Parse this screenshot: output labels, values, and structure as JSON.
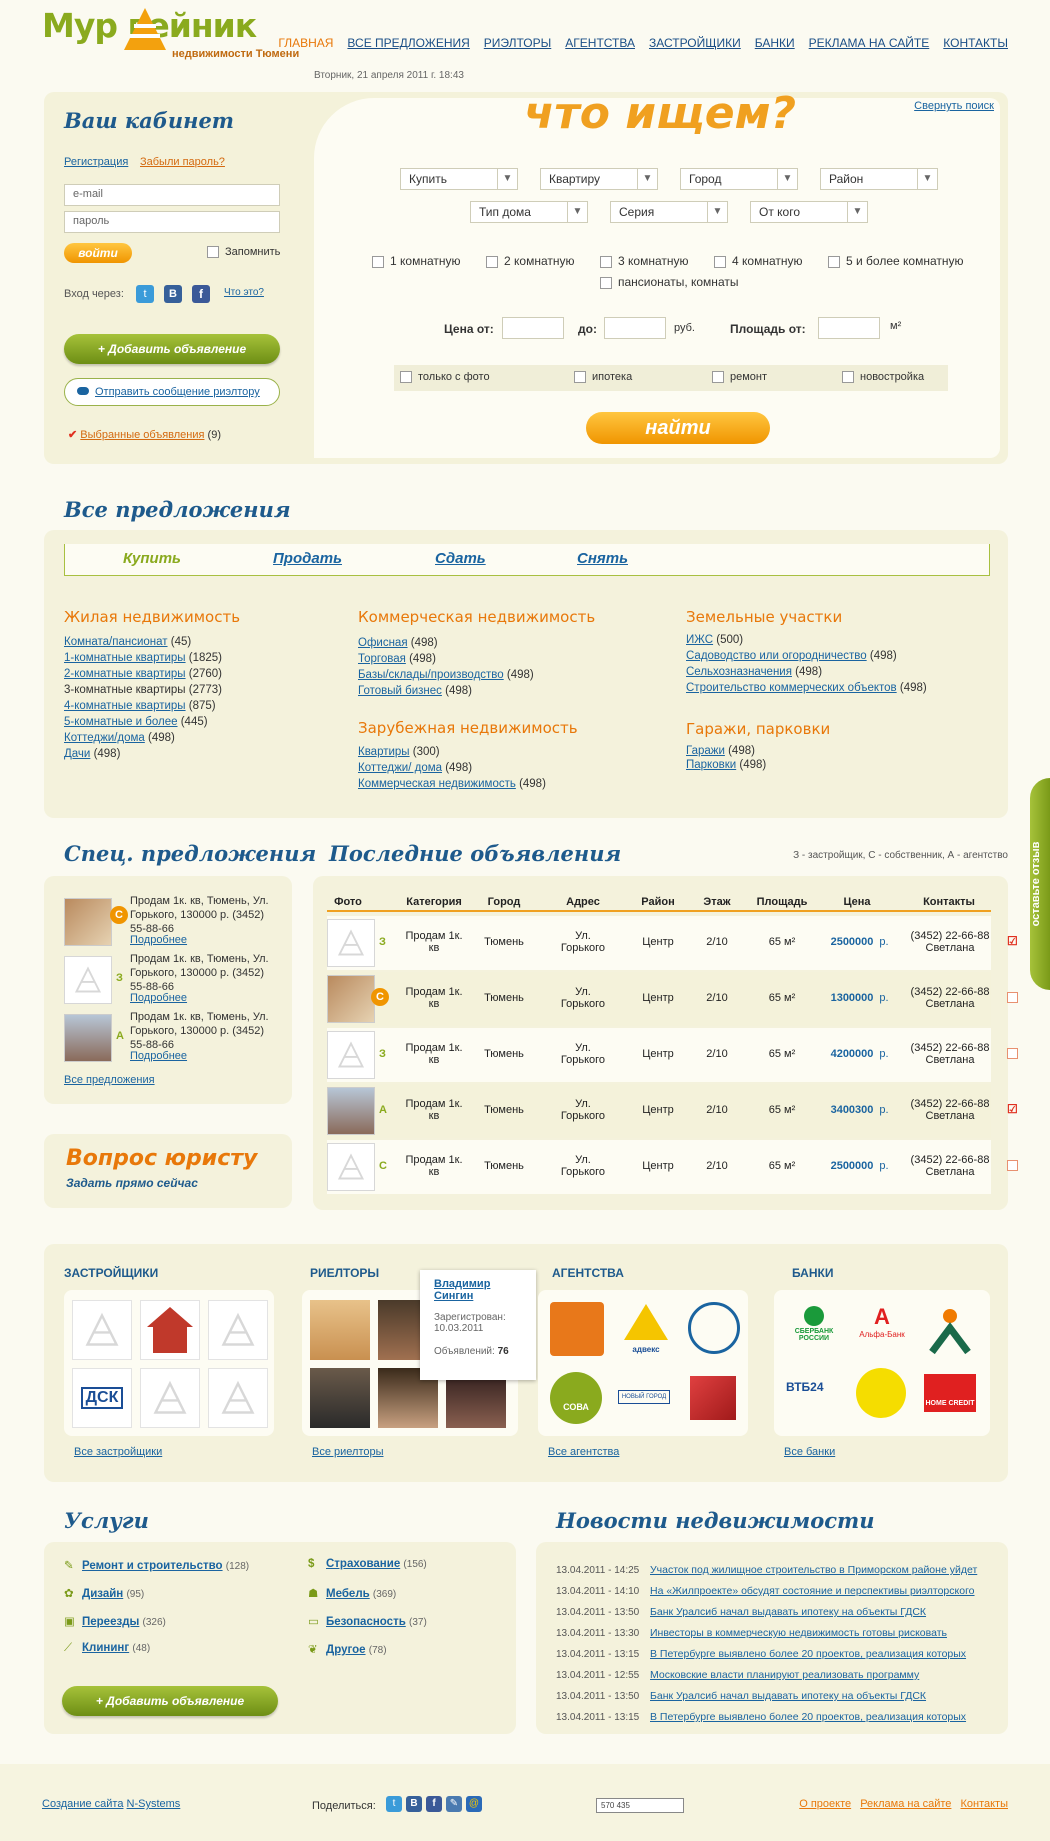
{
  "header": {
    "logo_text": "Мур    вейник",
    "logo_sub": "недвижимости Тюмени",
    "date": "Вторник, 21 апреля 2011 г. 18:43",
    "nav": [
      "ГЛАВНАЯ",
      "ВСЕ ПРЕДЛОЖЕНИЯ",
      "РИЭЛТОРЫ",
      "АГЕНТСТВА",
      "ЗАСТРОЙЩИКИ",
      "БАНКИ",
      "РЕКЛАМА НА САЙТЕ",
      "КОНТАКТЫ"
    ]
  },
  "cabinet": {
    "title": "Ваш кабинет",
    "register": "Регистрация",
    "forgot": "Забыли пароль?",
    "email_placeholder": "e-mail",
    "password_placeholder": "пароль",
    "login": "войти",
    "remember": "Запомнить",
    "login_via": "Вход через:",
    "what": "Что это?",
    "add": "+ Добавить объявление",
    "send": "Отправить сообщение риэлтору",
    "favorites": "Выбранные объявления",
    "favorites_count": "(9)"
  },
  "search": {
    "title": "что ищем?",
    "collapse": "Свернуть поиск",
    "selects": [
      "Купить",
      "Квартиру",
      "Город",
      "Район",
      "Тип дома",
      "Серия",
      "От кого"
    ],
    "rooms": [
      "1 комнатную",
      "2 комнатную",
      "3 комнатную",
      "4 комнатную",
      "5 и более комнатную",
      "пансионаты, комнаты"
    ],
    "price_from": "Цена от:",
    "to": "до:",
    "rub": "руб.",
    "area_from": "Площадь от:",
    "m2": "м²",
    "flags": [
      "только с фото",
      "ипотека",
      "ремонт",
      "новостройка"
    ],
    "find": "найти"
  },
  "offers": {
    "title": "Все предложения",
    "tabs": [
      "Купить",
      "Продать",
      "Сдать",
      "Снять"
    ],
    "residential": {
      "title": "Жилая недвижимость",
      "items": [
        [
          "Комната/пансионат",
          "(45)"
        ],
        [
          "1-комнатные квартиры",
          "(1825)"
        ],
        [
          "2-комнатные квартиры",
          "(2760)"
        ],
        [
          "3-комнатные квартиры",
          "(2773)"
        ],
        [
          "4-комнатные квартиры",
          "(875)"
        ],
        [
          "5-комнатные и более",
          "(445)"
        ],
        [
          "Коттеджи/дома",
          "(498)"
        ],
        [
          "Дачи",
          "(498)"
        ]
      ]
    },
    "commercial": {
      "title": "Коммерческая недвижимость",
      "items": [
        [
          "Офисная",
          "(498)"
        ],
        [
          "Торговая",
          "(498)"
        ],
        [
          "Базы/склады/производство",
          "(498)"
        ],
        [
          "Готовый бизнес",
          "(498)"
        ]
      ]
    },
    "foreign": {
      "title": "Зарубежная недвижимость",
      "items": [
        [
          "Квартиры",
          "(300)"
        ],
        [
          "Коттеджи/ дома",
          "(498)"
        ],
        [
          "Коммерческая недвижимость",
          "(498)"
        ]
      ]
    },
    "land": {
      "title": "Земельные участки",
      "items": [
        [
          "ИЖС",
          "(500)"
        ],
        [
          "Садоводство или огородничество",
          "(498)"
        ],
        [
          "Сельхозназначения",
          "(498)"
        ],
        [
          "Строительство коммерческих объектов",
          "(498)"
        ]
      ]
    },
    "garages": {
      "title": "Гаражи, парковки",
      "items": [
        [
          "Гаражи",
          "(498)"
        ],
        [
          "Парковки",
          "(498)"
        ]
      ]
    }
  },
  "special": {
    "title": "Спец. предложения",
    "items": [
      {
        "badge": "С",
        "text": "Продам 1к. кв, Тюмень, Ул. Горького, 130000 р. (3452) 55-88-66",
        "more": "Подробнее"
      },
      {
        "badge": "З",
        "text": "Продам 1к. кв, Тюмень, Ул. Горького, 130000 р. (3452) 55-88-66",
        "more": "Подробнее"
      },
      {
        "badge": "А",
        "text": "Продам 1к. кв, Тюмень, Ул. Горького, 130000 р. (3452) 55-88-66",
        "more": "Подробнее"
      }
    ],
    "all": "Все предложения"
  },
  "lawyer": {
    "title": "Вопрос юристу",
    "sub": "Задать прямо сейчас"
  },
  "latest": {
    "title": "Последние объявления",
    "legend": [
      "З - застройщик,",
      "С - собственник,",
      "А - агентство"
    ],
    "cols": [
      "Фото",
      "Категория",
      "Город",
      "Адрес",
      "Район",
      "Этаж",
      "Площадь",
      "Цена",
      "Контакты"
    ],
    "rows": [
      {
        "badge": "З",
        "cat": "Продам 1к. кв",
        "city": "Тюмень",
        "addr": "Ул. Горького",
        "district": "Центр",
        "floor": "2/10",
        "area": "65 м²",
        "price": "2500000",
        "cur": "р.",
        "contact": "(3452) 22-66-88 Светлана",
        "checked": true
      },
      {
        "badge": "С",
        "cat": "Продам 1к. кв",
        "city": "Тюмень",
        "addr": "Ул. Горького",
        "district": "Центр",
        "floor": "2/10",
        "area": "65 м²",
        "price": "1300000",
        "cur": "р.",
        "contact": "(3452) 22-66-88 Светлана",
        "checked": false
      },
      {
        "badge": "З",
        "cat": "Продам 1к. кв",
        "city": "Тюмень",
        "addr": "Ул. Горького",
        "district": "Центр",
        "floor": "2/10",
        "area": "65 м²",
        "price": "4200000",
        "cur": "р.",
        "contact": "(3452) 22-66-88 Светлана",
        "checked": false
      },
      {
        "badge": "А",
        "cat": "Продам 1к. кв",
        "city": "Тюмень",
        "addr": "Ул. Горького",
        "district": "Центр",
        "floor": "2/10",
        "area": "65 м²",
        "price": "3400300",
        "cur": "р.",
        "contact": "(3452) 22-66-88 Светлана",
        "checked": true
      },
      {
        "badge": "С",
        "cat": "Продам 1к. кв",
        "city": "Тюмень",
        "addr": "Ул. Горького",
        "district": "Центр",
        "floor": "2/10",
        "area": "65 м²",
        "price": "2500000",
        "cur": "р.",
        "contact": "(3452) 22-66-88 Светлана",
        "checked": false
      }
    ],
    "feedback": "оставьте отзыв"
  },
  "partners": {
    "developers": {
      "title": "ЗАСТРОЙЩИКИ",
      "all": "Все застройщики",
      "logo_text": "ДСК"
    },
    "realtors": {
      "title": "РИЕЛТОРЫ",
      "all": "Все риелторы",
      "popup_name": "Владимир Сингин",
      "popup_reg": "Зарегистрован: 10.03.2011",
      "popup_ads_label": "Объявлений:",
      "popup_ads": "76"
    },
    "agencies": {
      "title": "АГЕНТСТВА",
      "all": "Все агентства",
      "logos": [
        "адвекс",
        "СОВА",
        "НОВЫЙ ГОРОД"
      ]
    },
    "banks": {
      "title": "БАНКИ",
      "all": "Все банки",
      "logos": [
        "СБЕРБАНК РОССИИ",
        "Альфа-Банк",
        "ВТБ24",
        "HOME CREDIT"
      ]
    }
  },
  "services": {
    "title": "Услуги",
    "items": [
      [
        "Ремонт и строительство",
        "(128)"
      ],
      [
        "Дизайн",
        "(95)"
      ],
      [
        "Переезды",
        "(326)"
      ],
      [
        "Клининг",
        "(48)"
      ],
      [
        "Страхование",
        "(156)"
      ],
      [
        "Мебель",
        "(369)"
      ],
      [
        "Безопасность",
        "(37)"
      ],
      [
        "Другое",
        "(78)"
      ]
    ],
    "add": "+ Добавить объявление"
  },
  "news": {
    "title": "Новости недвижимости",
    "items": [
      [
        "13.04.2011 - 14:25",
        "Участок под жилищное строительство в Приморском районе уйдет"
      ],
      [
        "13.04.2011 - 14:10",
        "На «Жилпроекте» обсудят состояние и перспективы риэлторского"
      ],
      [
        "13.04.2011 - 13:50",
        "Банк Уралсиб начал выдавать ипотеку на объекты ГДСК"
      ],
      [
        "13.04.2011 - 13:30",
        "Инвесторы в коммерческую недвижимость готовы рисковать"
      ],
      [
        "13.04.2011 - 13:15",
        "В Петербурге выявлено более 20 проектов, реализация которых"
      ],
      [
        "13.04.2011 - 12:55",
        "Московские власти планируют реализовать программу"
      ],
      [
        "13.04.2011 - 13:50",
        "Банк Уралсиб начал выдавать ипотеку на объекты ГДСК"
      ],
      [
        "13.04.2011 - 13:15",
        "В Петербурге выявлено более 20 проектов, реализация которых"
      ]
    ]
  },
  "footer": {
    "made": "Создание сайта",
    "made_by": "N-Systems",
    "share": "Поделиться:",
    "counter": "570 435",
    "links": [
      "О проекте",
      "Реклама на сайте",
      "Контакты"
    ]
  },
  "colors": {
    "accent": "#e8780a",
    "link": "#1a64a0",
    "green": "#8aaa1e",
    "panel": "#f4f2da"
  }
}
